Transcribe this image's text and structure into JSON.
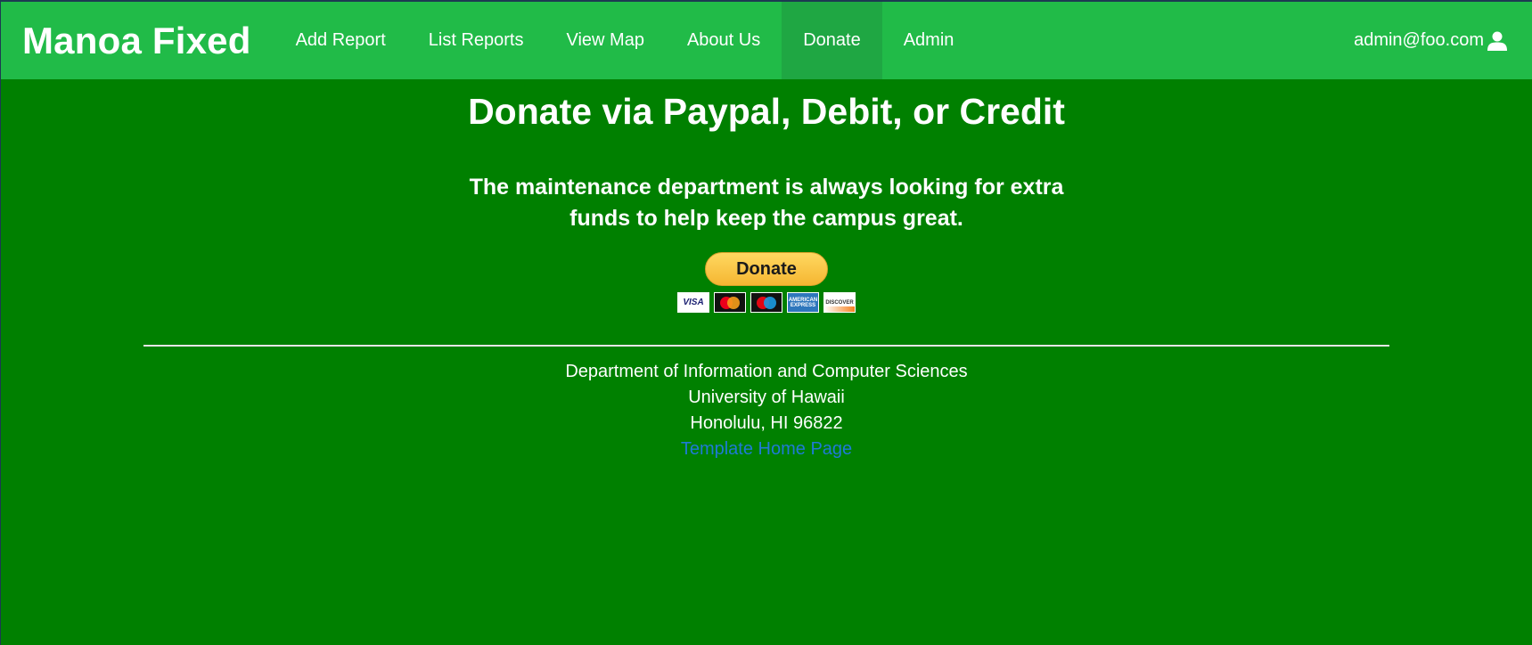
{
  "navbar": {
    "brand": "Manoa Fixed",
    "items": [
      {
        "label": "Add Report"
      },
      {
        "label": "List Reports"
      },
      {
        "label": "View Map"
      },
      {
        "label": "About Us"
      },
      {
        "label": "Donate",
        "active": true
      },
      {
        "label": "Admin"
      }
    ],
    "user": {
      "email": "admin@foo.com",
      "icon": "user-icon"
    }
  },
  "main": {
    "heading": "Donate via Paypal, Debit, or Credit",
    "subtext": "The maintenance department is always looking for extra funds to help keep the campus great.",
    "donate_button_label": "Donate",
    "cards": [
      {
        "name": "visa",
        "label": "VISA"
      },
      {
        "name": "mastercard",
        "label": ""
      },
      {
        "name": "maestro",
        "label": ""
      },
      {
        "name": "amex",
        "label": "AMERICAN EXPRESS"
      },
      {
        "name": "discover",
        "label": "DISCOVER"
      }
    ]
  },
  "footer": {
    "lines": [
      "Department of Information and Computer Sciences",
      "University of Hawaii",
      "Honolulu, HI 96822"
    ],
    "link": "Template Home Page"
  },
  "colors": {
    "page_background": "#008000",
    "navbar_background": "#21bb48",
    "navbar_active": "#1fa743",
    "link": "#1f7ad6",
    "donate_button": "#ffc439"
  }
}
